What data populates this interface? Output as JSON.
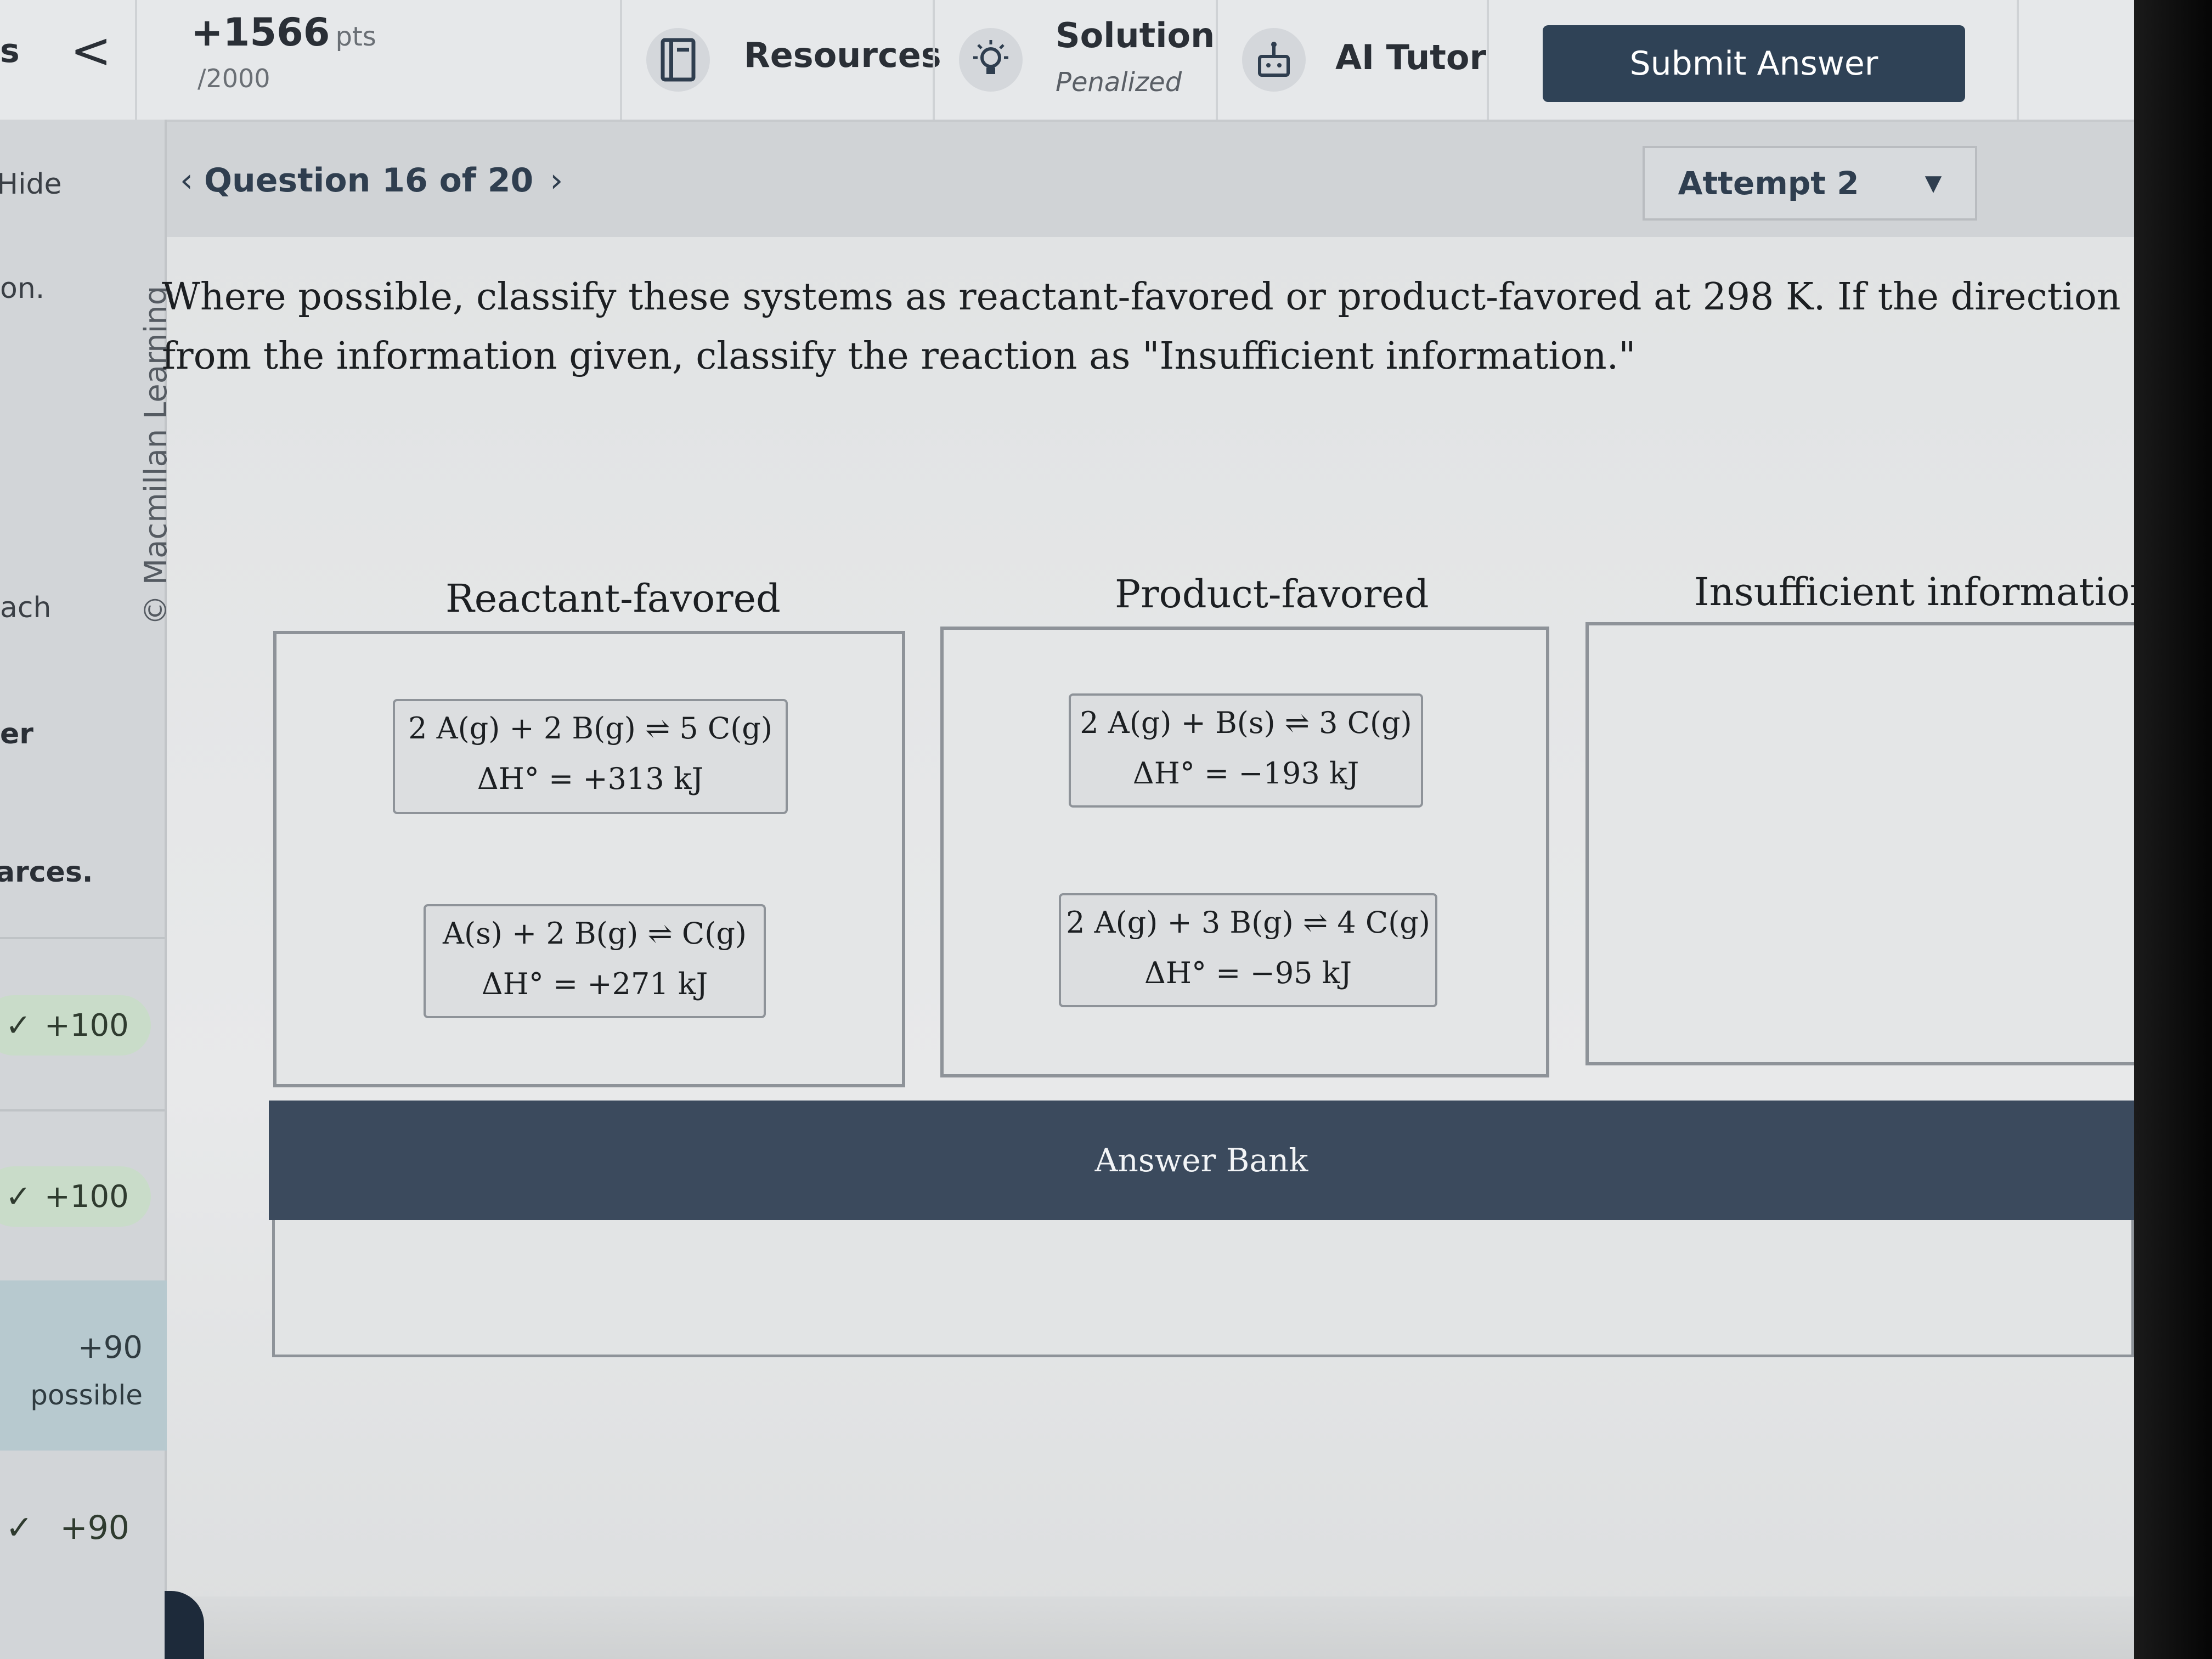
{
  "topbar": {
    "nav_fragment": "s",
    "back_glyph": "<",
    "points": "+1566",
    "points_unit": "pts",
    "points_total": "/2000",
    "resources_label": "Resources",
    "solution_label": "Solution",
    "solution_sub": "Penalized",
    "ai_tutor_label": "AI Tutor",
    "submit_label": "Submit Answer"
  },
  "sidebar": {
    "hide": "Hide",
    "frag1": "on.",
    "frag2": "ach",
    "frag3": "er",
    "frag4": "arces.",
    "scores": [
      "+100",
      "+100"
    ],
    "possible_value": "+90",
    "possible_label": "possible",
    "last_score": "+90"
  },
  "question_nav": {
    "label": "Question 16 of 20",
    "attempt": "Attempt 2"
  },
  "question": {
    "watermark": "© Macmillan Learning",
    "prompt_line1": "Where possible, classify these systems as reactant-favored or product-favored at 298 K. If the direction cannot be determ",
    "prompt_line2": "from the information given, classify the reaction as \"Insufficient information.\"",
    "columns": [
      {
        "title": "Reactant-favored",
        "cards": [
          {
            "equation": "2 A(g) + 2 B(g) ⇌ 5 C(g)",
            "enthalpy": "ΔH° = +313 kJ"
          },
          {
            "equation": "A(s) + 2 B(g) ⇌ C(g)",
            "enthalpy": "ΔH° = +271 kJ"
          }
        ]
      },
      {
        "title": "Product-favored",
        "cards": [
          {
            "equation": "2 A(g) + B(s) ⇌ 3 C(g)",
            "enthalpy": "ΔH° = −193 kJ"
          },
          {
            "equation": "2 A(g) + 3 B(g) ⇌ 4 C(g)",
            "enthalpy": "ΔH° = −95 kJ"
          }
        ]
      },
      {
        "title": "Insufficient information",
        "cards": []
      }
    ],
    "answer_bank_label": "Answer Bank"
  }
}
